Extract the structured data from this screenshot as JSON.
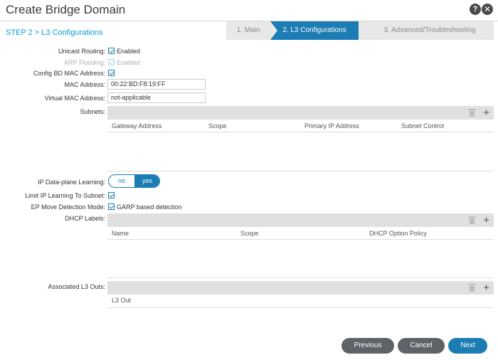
{
  "header": {
    "title": "Create Bridge Domain",
    "help_icon": "?",
    "close_icon": "✕"
  },
  "step_label": "STEP 2 > L3 Configurations",
  "wizard": {
    "steps": [
      "1. Main",
      "2. L3 Configurations",
      "3. Advanced/Troubleshooting"
    ],
    "active_index": 1
  },
  "form": {
    "unicast_routing": {
      "label": "Unicast Routing:",
      "text": "Enabled",
      "checked": true
    },
    "arp_flooding": {
      "label": "ARP Flooding:",
      "text": "Enabled",
      "checked": true,
      "disabled": true
    },
    "config_bd_mac": {
      "label": "Config BD MAC Address:",
      "checked": true
    },
    "mac_address": {
      "label": "MAC Address:",
      "value": "00:22:BD:F8:19:FF"
    },
    "virtual_mac": {
      "label": "Virtual MAC Address:",
      "value": "not-applicable"
    },
    "subnets": {
      "label": "Subnets:",
      "columns": [
        "Gateway Address",
        "Scope",
        "Primary IP Address",
        "Subnet Control"
      ]
    },
    "ip_learning": {
      "label": "IP Data-plane Learning:",
      "options": [
        "no",
        "yes"
      ],
      "selected": "yes"
    },
    "limit_ip": {
      "label": "Limit IP Learning To Subnet:",
      "checked": true
    },
    "ep_move": {
      "label": "EP Move Detection Mode:",
      "text": "GARP based detection",
      "checked": true
    },
    "dhcp": {
      "label": "DHCP Labels:",
      "columns": [
        "Name",
        "Scope",
        "DHCP Option Policy"
      ]
    },
    "l3outs": {
      "label": "Associated L3 Outs:",
      "columns": [
        "L3 Out"
      ]
    }
  },
  "footer": {
    "previous": "Previous",
    "cancel": "Cancel",
    "next": "Next"
  },
  "colors": {
    "accent": "#1b7db3",
    "step_label": "#049fd9",
    "button_gray": "#5f6368"
  }
}
